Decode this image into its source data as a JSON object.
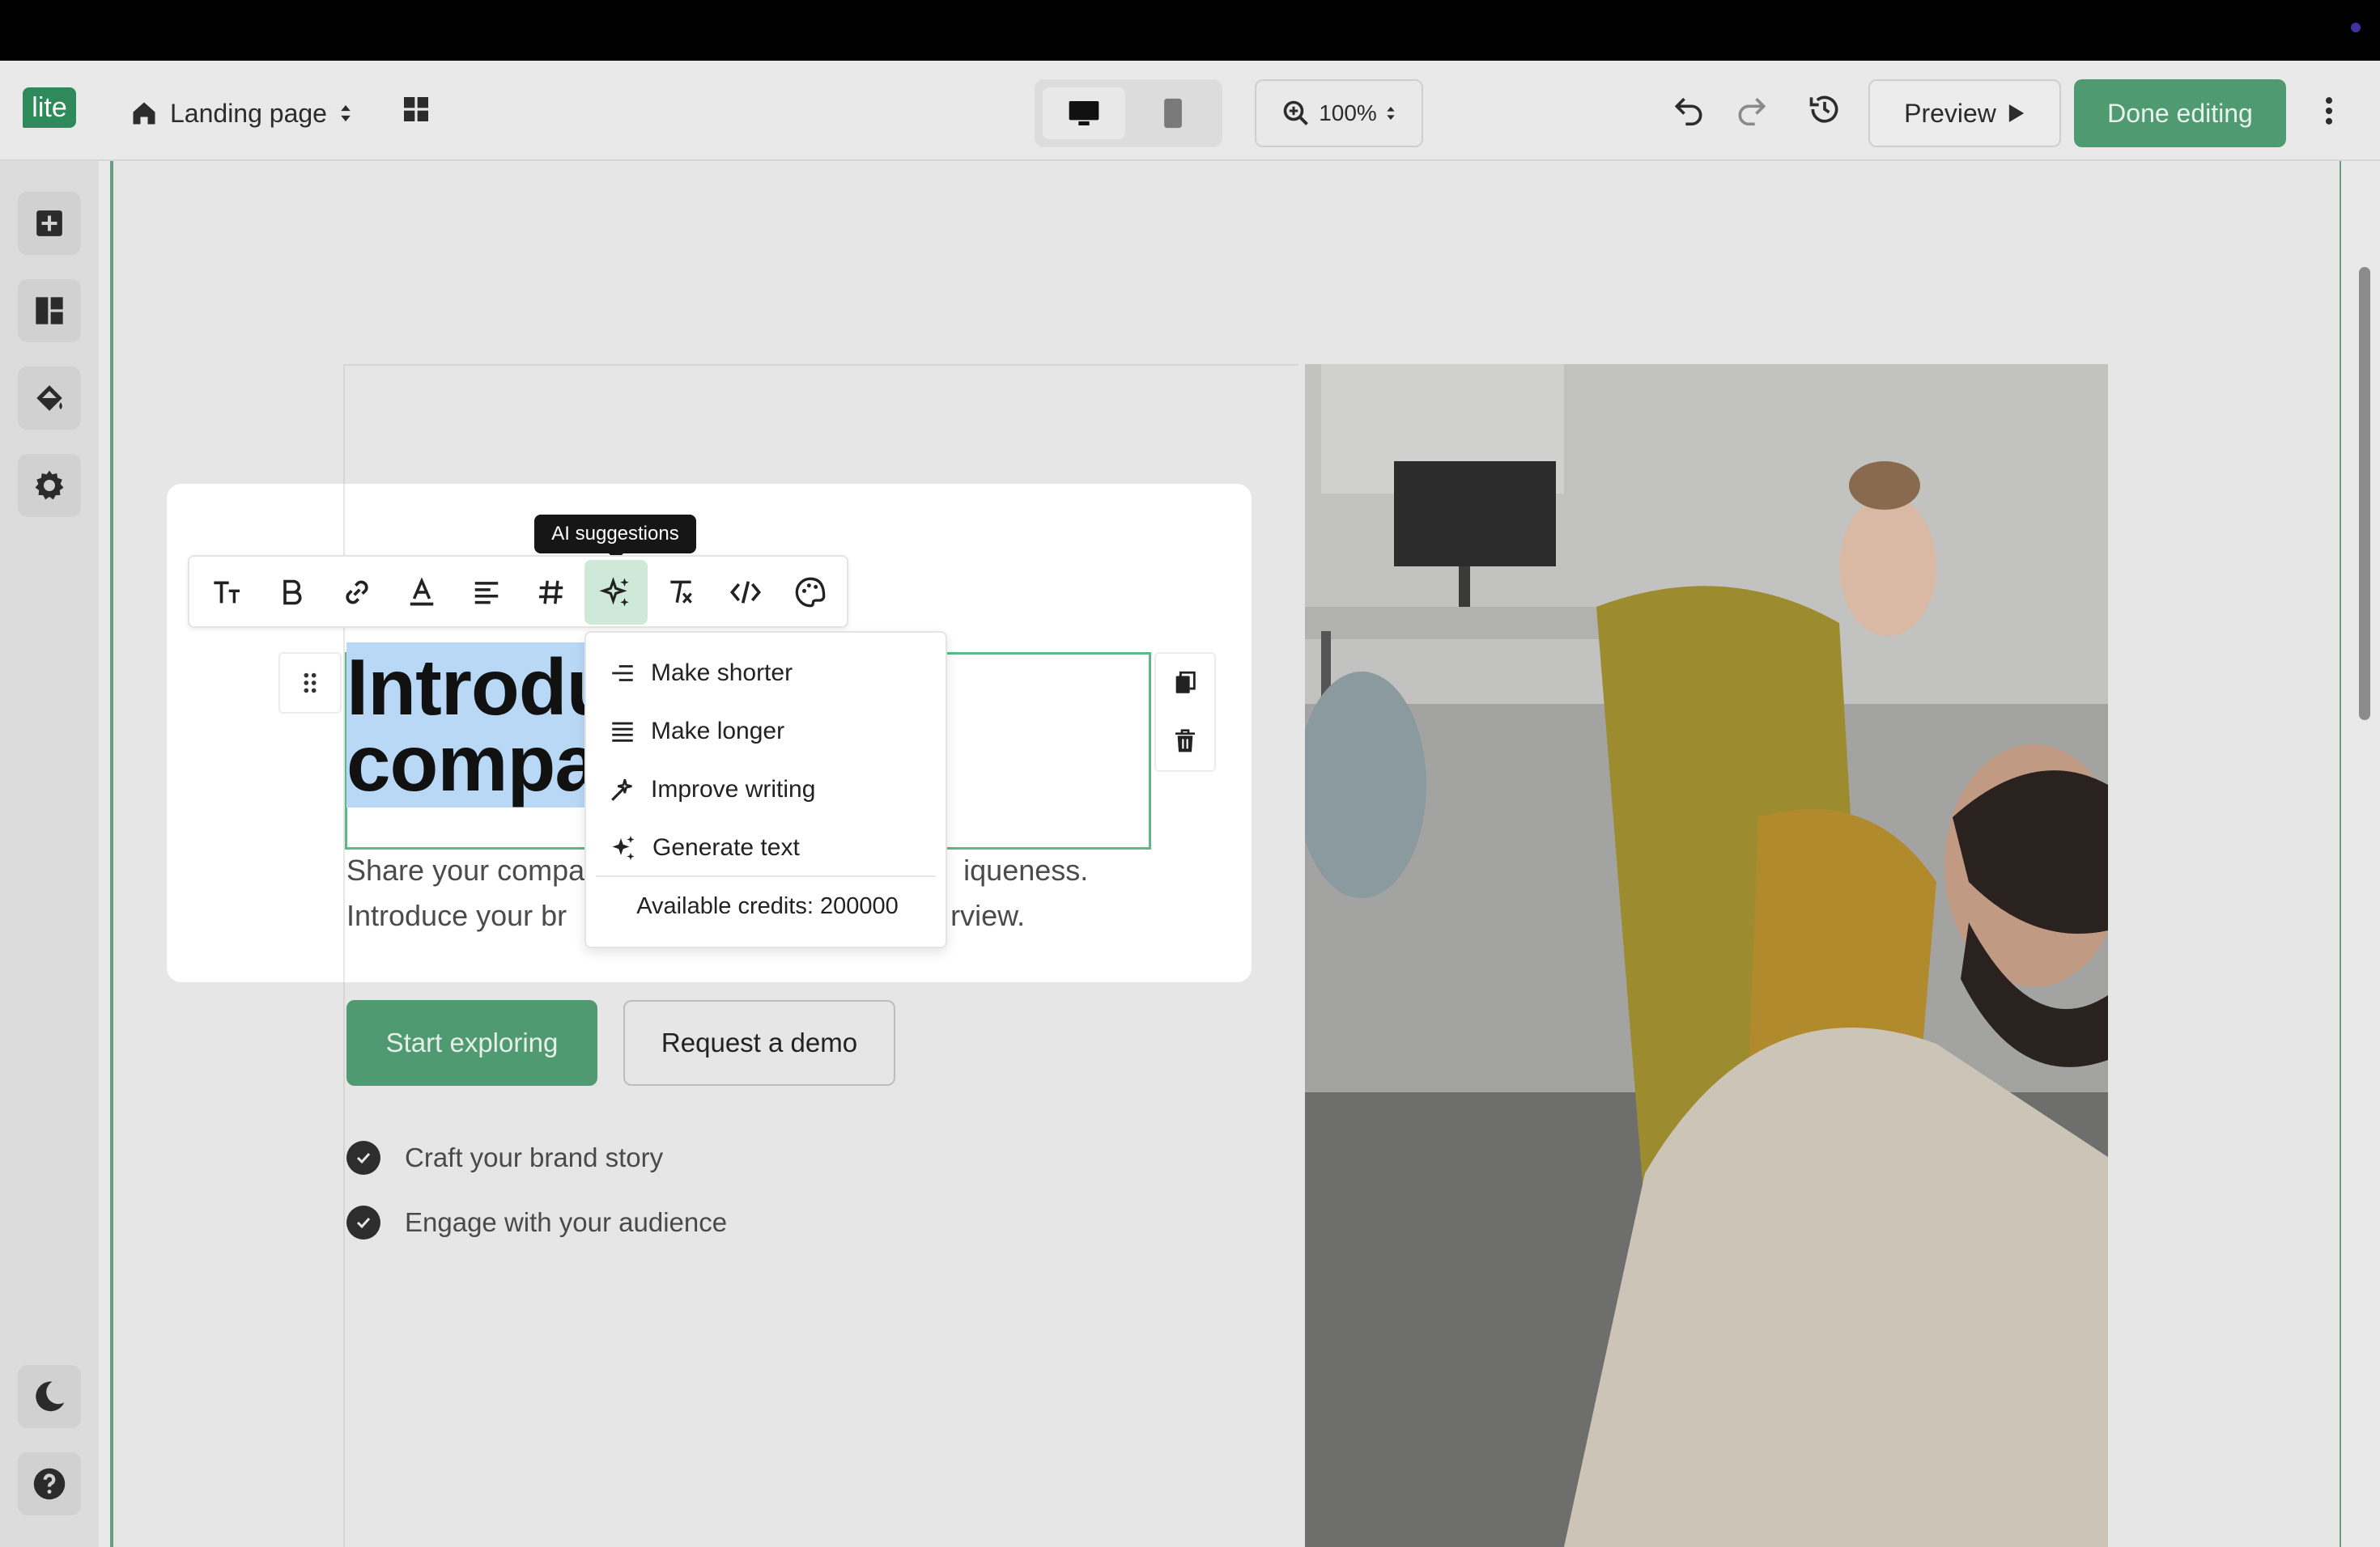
{
  "app": {
    "logo_text": "lite"
  },
  "toolbar": {
    "page_name": "Landing page",
    "zoom_level": "100%",
    "preview_label": "Preview",
    "done_label": "Done editing",
    "accent_color": "#4f9a70"
  },
  "sidebar": {
    "items": [
      {
        "name": "add-block",
        "icon": "plus-square-icon"
      },
      {
        "name": "layout",
        "icon": "dashboard-icon"
      },
      {
        "name": "theme",
        "icon": "paint-bucket-icon"
      },
      {
        "name": "settings",
        "icon": "gear-icon"
      }
    ],
    "bottom": [
      {
        "name": "dark-mode",
        "icon": "moon-icon"
      },
      {
        "name": "help",
        "icon": "question-circle-icon"
      }
    ]
  },
  "editor": {
    "tooltip": "AI suggestions",
    "format_tools": [
      "text-size",
      "bold",
      "link",
      "text-color",
      "align",
      "heading-anchor",
      "ai-suggestions",
      "clear-format",
      "code",
      "style"
    ],
    "heading_line1": "Introdu",
    "heading_line2": "compa",
    "description_line1_start": "Share your compa",
    "description_line1_end": "iqueness.",
    "description_line2_start": "Introduce your br",
    "description_line2_end": "rview."
  },
  "ai_menu": {
    "items": [
      {
        "label": "Make shorter",
        "icon": "short-lines-icon"
      },
      {
        "label": "Make longer",
        "icon": "long-lines-icon"
      },
      {
        "label": "Improve writing",
        "icon": "magic-wand-icon"
      },
      {
        "label": "Generate text",
        "icon": "sparkles-icon"
      }
    ],
    "credits": "Available credits: 200000"
  },
  "hero": {
    "primary_button": "Start exploring",
    "secondary_button": "Request a demo",
    "features": [
      "Craft your brand story",
      "Engage with your audience"
    ]
  }
}
